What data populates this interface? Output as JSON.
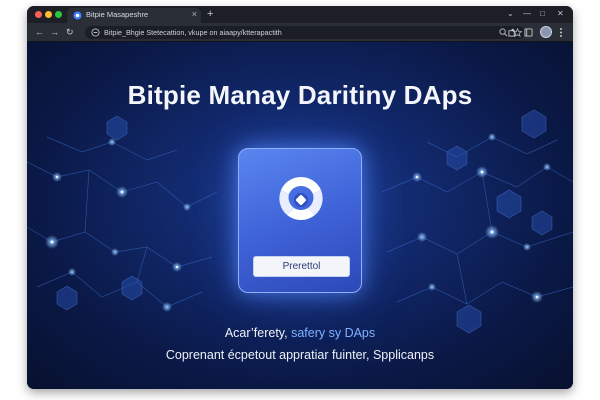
{
  "browser": {
    "tab": {
      "title": "Bitpie Masapeshre",
      "close_glyph": "×",
      "favicon": "bitpie-favicon"
    },
    "new_tab_glyph": "+",
    "window_controls": {
      "chevron": "⌄",
      "minimize": "—",
      "maximize": "□",
      "close": "✕"
    },
    "nav": {
      "back_glyph": "←",
      "forward_glyph": "→",
      "reload_glyph": "↻"
    },
    "address_bar": {
      "text": "Bitpie_Bhgie Stetecattion, vkupe on aiaapy/ktterapactith",
      "icon": "site-info-icon"
    },
    "toolbar_icons": [
      "zoom-icon",
      "star-icon",
      "extensions-icon",
      "tab-search-icon",
      "profile-avatar",
      "menu-icon"
    ],
    "colors": {
      "frame": "#1c1f26",
      "toolbar": "#2a2e37",
      "accent": "#7fb2ff"
    }
  },
  "page": {
    "title": "Bitpie Manay Daritiny DAps",
    "card": {
      "logo": "bitpie-logo",
      "button_label": "Prerettol"
    },
    "tagline": {
      "before": "Acar’ferety, ",
      "highlight": "safery sy DAps"
    },
    "subline": "Coprenant écpetout appratiar fuinter, Spplicanps",
    "colors": {
      "background": "#0b1a4a",
      "card": "#4a72e6",
      "highlight": "#7fb2ff"
    }
  }
}
